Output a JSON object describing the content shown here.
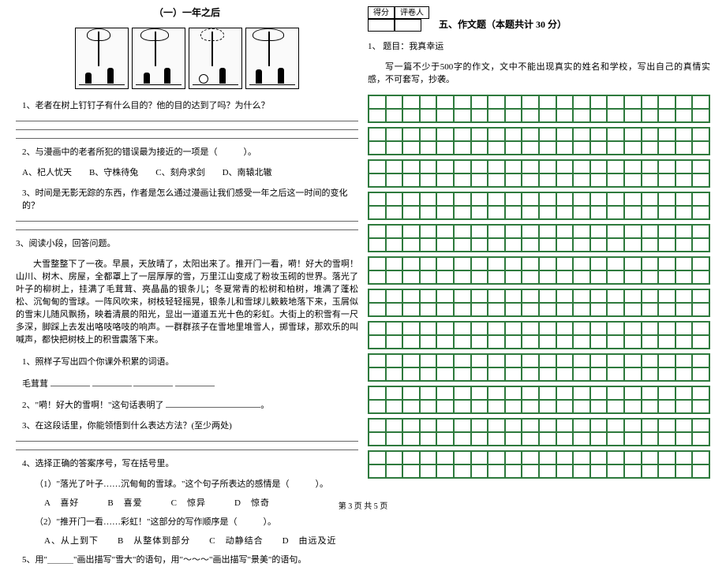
{
  "left": {
    "title": "（一）一年之后",
    "q1": "1、老者在树上钉钉子有什么目的？他的目的达到了吗？为什么？",
    "q2": "2、与漫画中的老者所犯的错误最为接近的一项是（　　　）。",
    "q2_opts": "A、杞人忧天　　B、守株待兔　　C、刻舟求剑　　D、南辕北辙",
    "q3": "3、时间是无影无踪的东西，作者是怎么通过漫画让我们感受一年之后这一时间的变化的？",
    "sec3_lead": "3、阅读小段，回答问题。",
    "passage": "大雪整整下了一夜。早晨，天放晴了，太阳出来了。推开门一看，嗬！好大的雪啊！山川、树木、房屋，全都罩上了一层厚厚的雪，万里江山变成了粉妆玉砌的世界。落光了叶子的柳树上，挂满了毛茸茸、亮晶晶的银条儿；冬夏常青的松树和柏树，堆满了蓬松松、沉甸甸的雪球。一阵风吹来，树枝轻轻摇晃，银条儿和雪球儿簌簌地落下来，玉屑似的雪末儿随风飘扬，映着清晨的阳光，显出一道道五光十色的彩虹。大街上的积雪有一尺多深，脚踩上去发出咯吱咯吱的响声。一群群孩子在雪地里堆雪人，掷雪球，那欢乐的叫喊声，都快把树枝上的积雪震落下来。",
    "p_q1": "1、照样子写出四个你课外积累的词语。",
    "p_q1_ex": "毛茸茸",
    "p_q2": "2、\"嗬！好大的雪啊！\"这句话表明了",
    "p_q3": "3、在这段话里，你能领悟到什么表达方法？(至少两处)",
    "p_q4": "4、选择正确的答案序号，写在括号里。",
    "p_q4_1": "（1）\"落光了叶子……沉甸甸的雪球。\"这个句子所表达的感情是（　　　）。",
    "p_q4_1_opts": "A　喜好　　　B　喜爱　　　C　惊异　　　D　惊奇",
    "p_q4_2": "（2）\"推开门一看……彩虹！\"这部分的写作顺序是（　　　）。",
    "p_q4_2_opts": "A、从上到下　　B　从整体到部分　　C　动静结合　　D　由远及近",
    "p_q5": "5、用\"＿＿＿\"画出描写\"雪大\"的语句，用\"～～～\"画出描写\"景美\"的语句。"
  },
  "right": {
    "score_l": "得分",
    "score_r": "评卷人",
    "sec_title": "五、作文题（本题共计 30 分）",
    "prompt_head": "1、 题目：我真幸运",
    "prompt_body": "写一篇不少于500字的作文，文中不能出现真实的姓名和学校，写出自己的真情实感，不可套写，抄袭。"
  },
  "footer": "第 3 页 共 5 页"
}
